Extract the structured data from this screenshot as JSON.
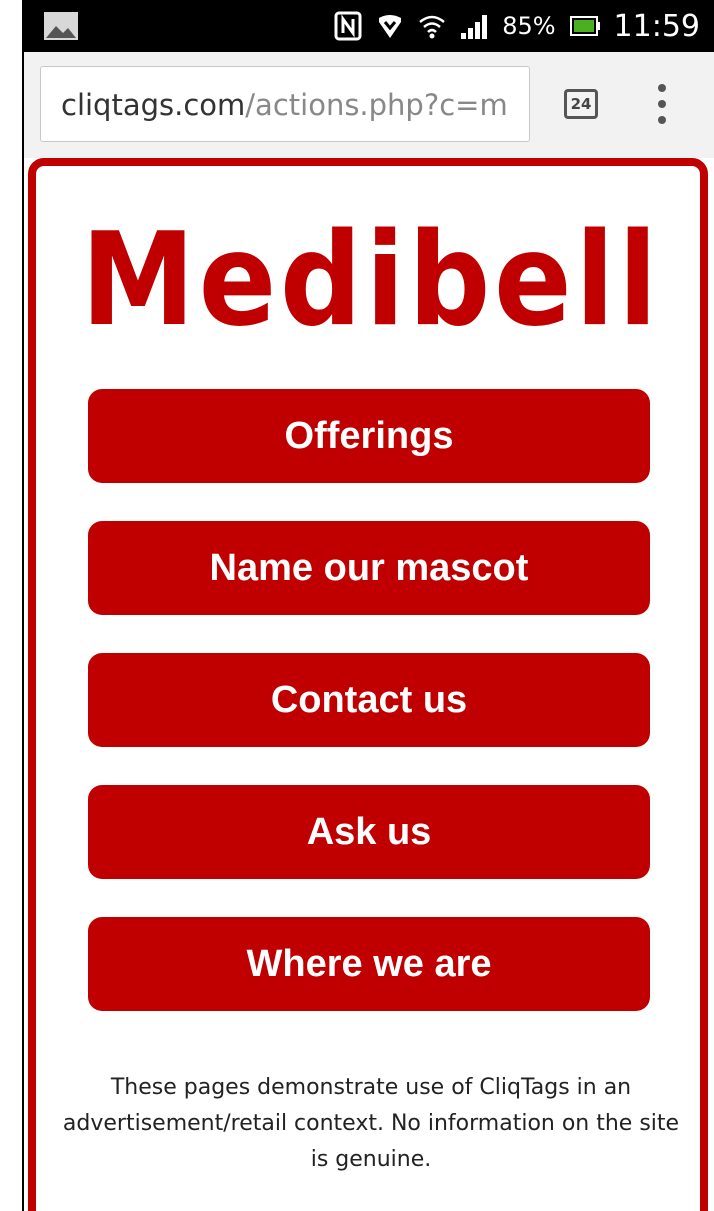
{
  "status_bar": {
    "icons": [
      "gallery-notification-icon",
      "nfc-icon",
      "data-saver-icon",
      "wifi-icon",
      "signal-icon",
      "battery-icon"
    ],
    "battery_percent": "85%",
    "time": "11:59"
  },
  "browser": {
    "url_host": "cliqtags.com",
    "url_path": "/actions.php?c=m",
    "tab_count": "24",
    "menu_icon": "overflow-menu-icon"
  },
  "page": {
    "logo_text": "Medibell",
    "brand_color": "#c00000",
    "buttons": [
      {
        "label": "Offerings"
      },
      {
        "label": "Name our mascot"
      },
      {
        "label": "Contact us"
      },
      {
        "label": "Ask us"
      },
      {
        "label": "Where we are"
      }
    ],
    "disclaimer": "These pages demonstrate use of CliqTags in an advertisement/retail context. No information on the site is genuine."
  }
}
